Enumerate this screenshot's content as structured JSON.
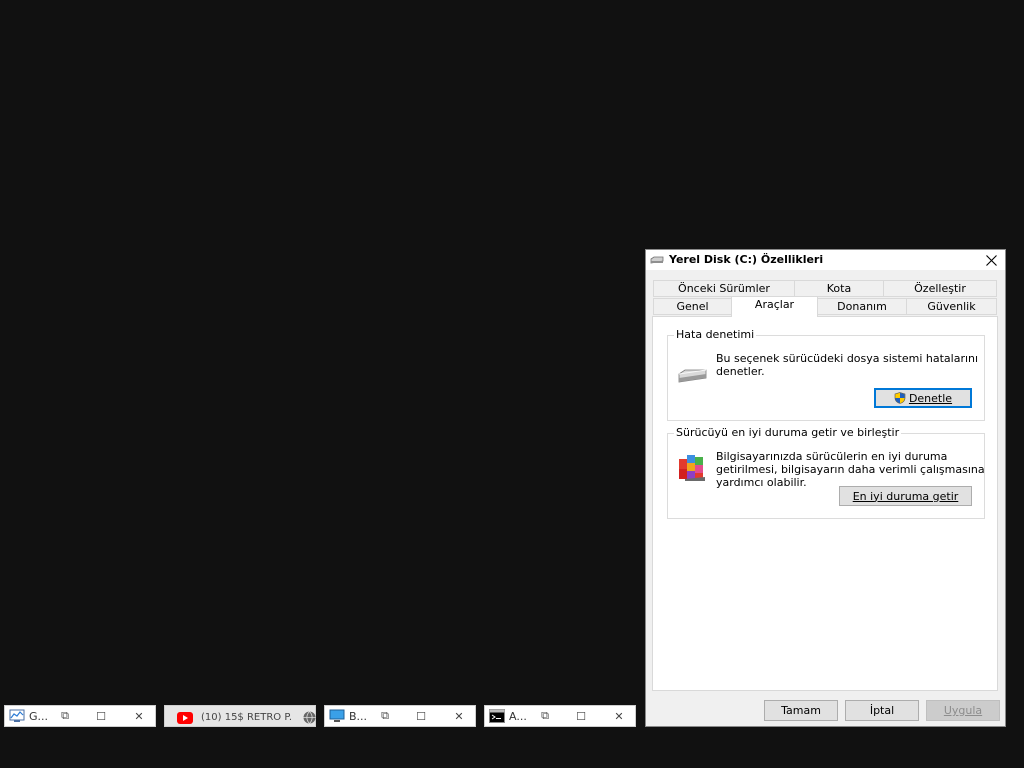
{
  "dialog": {
    "title": "Yerel Disk (C:) Özellikleri",
    "tabs_back": [
      "Önceki Sürümler",
      "Kota",
      "Özelleştir"
    ],
    "tabs_front": [
      "Genel",
      "Araçlar",
      "Donanım",
      "Güvenlik"
    ],
    "active_tab": "Araçlar",
    "error_check": {
      "group_label": "Hata denetimi",
      "description": "Bu seçenek sürücüdeki dosya sistemi hatalarını denetler.",
      "button_label": "Denetle"
    },
    "optimize": {
      "group_label": "Sürücüyü en iyi duruma getir ve birleştir",
      "description": "Bilgisayarınızda sürücülerin en iyi duruma getirilmesi, bilgisayarın daha verimli çalışmasına yardımcı olabilir.",
      "button_label": "En iyi duruma getir"
    },
    "footer": {
      "ok_label": "Tamam",
      "cancel_label": "İptal",
      "apply_label": "Uygula"
    }
  },
  "minimized_windows": [
    {
      "title": "G..."
    },
    {
      "title": "(10) 15$ RETRO P..."
    },
    {
      "title": "B..."
    },
    {
      "title": "A..."
    }
  ],
  "colors": {
    "desktop_bg": "#111111",
    "focus_accent": "#0078d7",
    "youtube_red": "#ff0000"
  }
}
